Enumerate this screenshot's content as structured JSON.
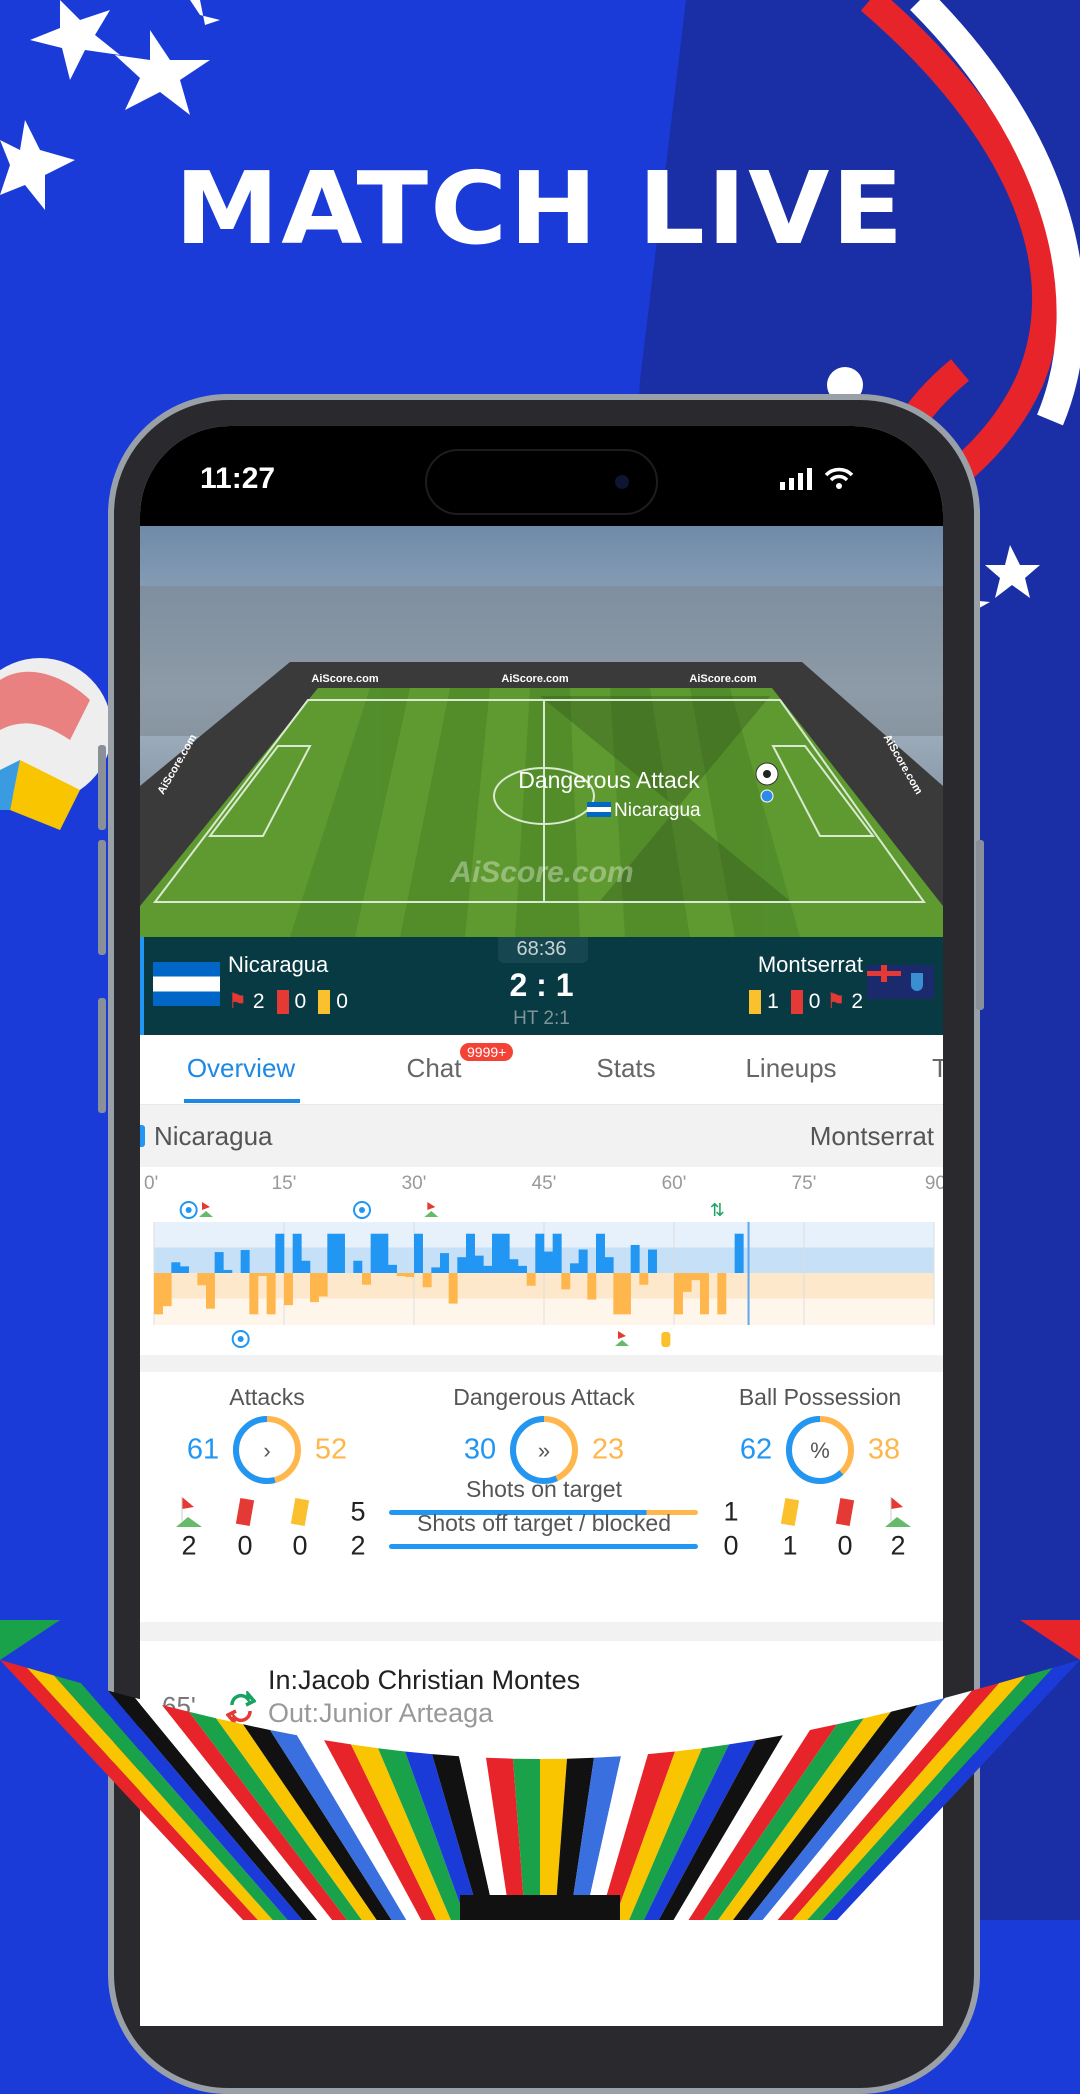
{
  "promo": {
    "title": "MATCH LIVE"
  },
  "status_bar": {
    "time": "11:27"
  },
  "pitch": {
    "event_label": "Dangerous Attack",
    "event_team": "Nicaragua",
    "watermark": "AiScore.com",
    "board_texts": [
      "AiScore.com",
      "AiScore.com",
      "AiScore.com",
      "AiScore.com",
      "AiScore.com"
    ]
  },
  "score": {
    "home": {
      "name": "Nicaragua",
      "corners": "2",
      "red": "0",
      "yellow": "0"
    },
    "away": {
      "name": "Montserrat",
      "yellow": "1",
      "red": "0",
      "corners": "2"
    },
    "clock": "68:36",
    "score": "2 : 1",
    "halftime": "HT 2:1"
  },
  "tabs": [
    {
      "label": "Overview",
      "active": true
    },
    {
      "label": "Chat",
      "badge": "9999+"
    },
    {
      "label": "Stats"
    },
    {
      "label": "Lineups"
    },
    {
      "label": "T"
    }
  ],
  "teams_header": {
    "home": "Nicaragua",
    "away": "Montserrat"
  },
  "timeline": {
    "ticks": [
      "0'",
      "15'",
      "30'",
      "45'",
      "60'",
      "75'",
      "90"
    ],
    "current_minute": 68.6,
    "home_pressure": {
      "2": 0.21,
      "3": 0.13,
      "7": 0.41,
      "8": 0.06,
      "10": 0.45,
      "14": 0.77,
      "16": 0.77,
      "17": 0.24,
      "20": 0.77,
      "21": 0.77,
      "23": 0.24,
      "25": 0.77,
      "26": 0.77,
      "27": 0.16,
      "30": 0.77,
      "32": 0.11,
      "33": 0.39,
      "35": 0.31,
      "36": 0.77,
      "37": 0.34,
      "38": 0.14,
      "39": 0.77,
      "40": 0.77,
      "41": 0.27,
      "42": 0.14,
      "44": 0.77,
      "45": 0.42,
      "46": 0.77,
      "48": 0.19,
      "49": 0.46,
      "51": 0.77,
      "52": 0.31,
      "55": 0.55,
      "57": 0.46,
      "67": 0.77
    },
    "away_pressure": {
      "0": 0.81,
      "1": 0.65,
      "5": 0.24,
      "6": 0.7,
      "11": 0.81,
      "12": 0.06,
      "13": 0.81,
      "15": 0.63,
      "18": 0.57,
      "19": 0.46,
      "24": 0.23,
      "28": 0.06,
      "29": 0.08,
      "31": 0.28,
      "34": 0.6,
      "43": 0.25,
      "47": 0.32,
      "50": 0.52,
      "53": 0.81,
      "54": 0.81,
      "56": 0.23,
      "60": 0.81,
      "61": 0.37,
      "62": 0.14,
      "63": 0.81,
      "65": 0.81
    },
    "home_events": [
      {
        "minute": 4,
        "type": "goal"
      },
      {
        "minute": 6,
        "type": "corner"
      },
      {
        "minute": 24,
        "type": "goal"
      },
      {
        "minute": 32,
        "type": "corner"
      },
      {
        "minute": 65,
        "type": "substitution"
      }
    ],
    "away_events": [
      {
        "minute": 10,
        "type": "goal"
      },
      {
        "minute": 54,
        "type": "corner"
      },
      {
        "minute": 59,
        "type": "yellow-card"
      }
    ]
  },
  "stats": {
    "rings": [
      {
        "label": "Attacks",
        "home": "61",
        "away": "52",
        "icon": "chevron-right"
      },
      {
        "label": "Dangerous Attack",
        "home": "30",
        "away": "23",
        "icon": "triple-chevron"
      },
      {
        "label": "Ball Possession",
        "home": "62",
        "away": "38",
        "icon": "%"
      }
    ],
    "shots_on": {
      "label": "Shots on target",
      "home": "5",
      "away": "1"
    },
    "shots_off": {
      "label": "Shots off target / blocked",
      "home": "2",
      "away": "0"
    },
    "home": {
      "corners": "2",
      "red": "0",
      "yellow": "0"
    },
    "away": {
      "yellow": "1",
      "red": "0",
      "corners": "2"
    }
  },
  "events": [
    {
      "minute": "65'",
      "type": "substitution",
      "in": "In:Jacob Christian Montes",
      "out": "Out:Junior Arteaga"
    }
  ],
  "colors": {
    "home": "#2196f3",
    "away": "#ffb74d",
    "scorebar": "#083a44",
    "badge": "#f44336",
    "background": "#1b3bd9"
  }
}
